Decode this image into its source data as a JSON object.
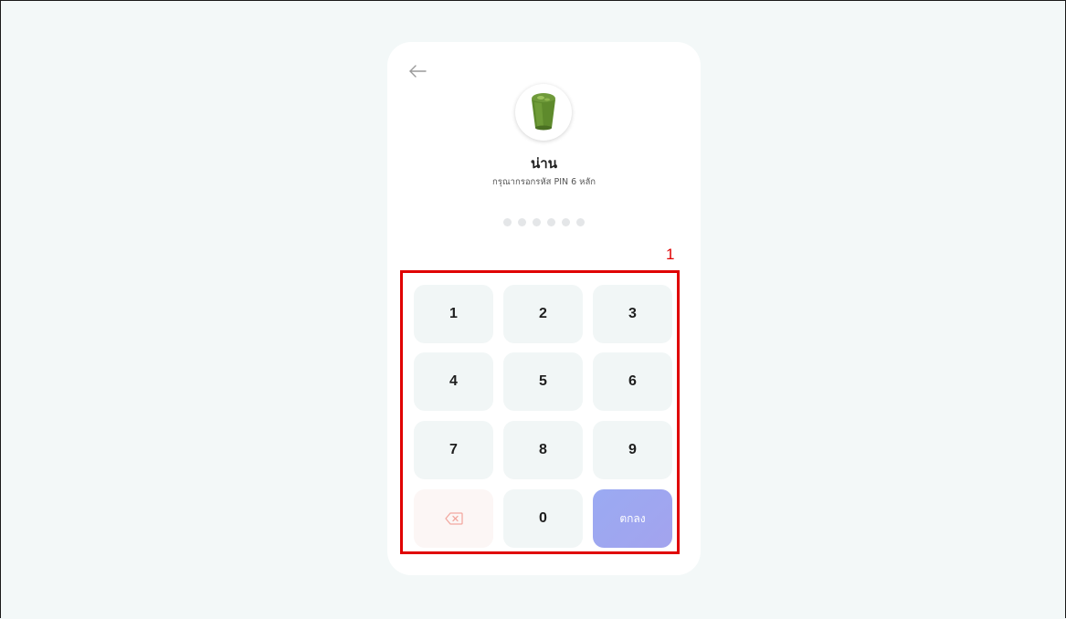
{
  "store": {
    "name": "น่าน",
    "prompt": "กรุณากรอกรหัส PIN 6 หลัก"
  },
  "pin": {
    "length": 6,
    "filled": 0
  },
  "keypad": {
    "keys": [
      "1",
      "2",
      "3",
      "4",
      "5",
      "6",
      "7",
      "8",
      "9"
    ],
    "zero": "0",
    "confirm_label": "ตกลง",
    "delete_icon": "backspace-icon"
  },
  "annotation": {
    "label": "1"
  },
  "icons": {
    "back": "arrow-left-icon",
    "avatar": "green-drink-icon"
  },
  "colors": {
    "background": "#f3f8f8",
    "key_bg": "#f1f6f6",
    "confirm_bg": "#9aaaf2",
    "annotation": "#e00000"
  }
}
